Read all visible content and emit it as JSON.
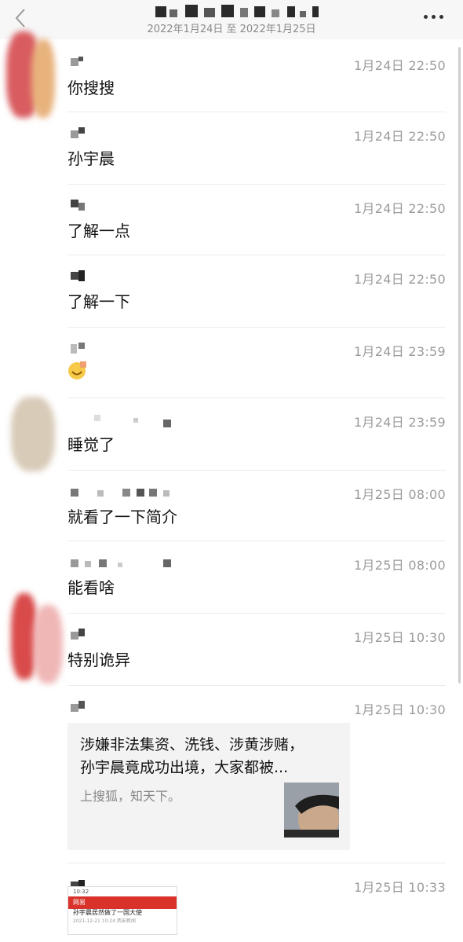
{
  "header": {
    "date_range": "2022年1月24日 至 2022年1月25日",
    "back_icon": "chevron-left-icon",
    "more_icon": "more-dots-icon"
  },
  "messages": [
    {
      "time": "1月24日 22:50",
      "text": "你搜搜"
    },
    {
      "time": "1月24日 22:50",
      "text": "孙宇晨"
    },
    {
      "time": "1月24日 22:50",
      "text": "了解一点"
    },
    {
      "time": "1月24日 22:50",
      "text": "了解一下"
    },
    {
      "time": "1月24日 23:59",
      "text": "",
      "emoji": "smile-emoji"
    },
    {
      "time": "1月24日 23:59",
      "text": "睡觉了"
    },
    {
      "time": "1月25日 08:00",
      "text": "就看了一下简介"
    },
    {
      "time": "1月25日 08:00",
      "text": "能看啥"
    },
    {
      "time": "1月25日 10:30",
      "text": "特别诡异"
    }
  ],
  "link_message": {
    "time": "1月25日 10:30",
    "title_line1": "涉嫌非法集资、洗钱、涉黄涉赌，",
    "title_line2": "孙宇晨竟成功出境，大家都被...",
    "source": "上搜狐，知天下。"
  },
  "image_message": {
    "time": "1月25日 10:33",
    "status_time": "10:32",
    "app_name": "网易",
    "headline": "孙宇晨居然做了一国大使",
    "meta": "2021-12-21 10:24 西安新闻"
  },
  "colors": {
    "header_bg": "#f7f7f7",
    "time_text": "#9b9b9b",
    "card_bg": "#f3f3f3",
    "image_bar": "#d8322b"
  }
}
